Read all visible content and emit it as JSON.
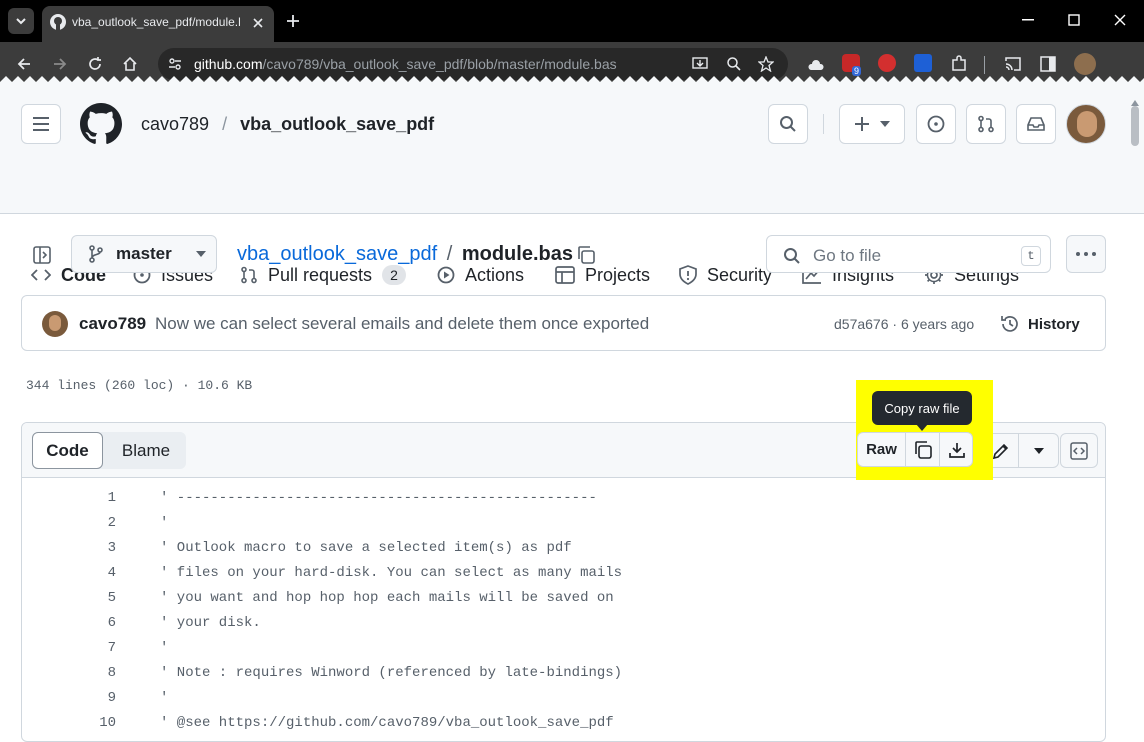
{
  "browser": {
    "tab_title": "vba_outlook_save_pdf/module.l",
    "url_domain": "github.com",
    "url_path": "/cavo789/vba_outlook_save_pdf/blob/master/module.bas",
    "ext_badge": "9"
  },
  "repo": {
    "owner": "cavo789",
    "separator": "/",
    "name": "vba_outlook_save_pdf"
  },
  "nav": [
    {
      "label": "Code",
      "icon": "code-icon"
    },
    {
      "label": "Issues",
      "icon": "issue-icon"
    },
    {
      "label": "Pull requests",
      "icon": "pull-request-icon",
      "count": "2"
    },
    {
      "label": "Actions",
      "icon": "play-icon"
    },
    {
      "label": "Projects",
      "icon": "table-icon"
    },
    {
      "label": "Security",
      "icon": "shield-icon"
    },
    {
      "label": "Insights",
      "icon": "graph-icon"
    },
    {
      "label": "Settings",
      "icon": "gear-icon"
    }
  ],
  "file": {
    "branch": "master",
    "repo_link": "vba_outlook_save_pdf",
    "separator": "/",
    "filename": "module.bas",
    "goto_placeholder": "Go to file",
    "goto_shortcut": "t"
  },
  "commit": {
    "author": "cavo789",
    "message": "Now we can select several emails and delete them once exported",
    "sha_time": "d57a676 · 6 years ago",
    "history_label": "History"
  },
  "stats": "344 lines (260 loc) · 10.6 KB",
  "viewer": {
    "code_tab": "Code",
    "blame_tab": "Blame",
    "raw_label": "Raw",
    "tooltip": "Copy raw file",
    "highlight_color": "#ffff00"
  },
  "code_lines": [
    {
      "n": "1",
      "text": "' --------------------------------------------------"
    },
    {
      "n": "2",
      "text": "'"
    },
    {
      "n": "3",
      "text": "' Outlook macro to save a selected item(s) as pdf"
    },
    {
      "n": "4",
      "text": "' files on your hard-disk. You can select as many mails"
    },
    {
      "n": "5",
      "text": "' you want and hop hop hop each mails will be saved on"
    },
    {
      "n": "6",
      "text": "' your disk."
    },
    {
      "n": "7",
      "text": "'"
    },
    {
      "n": "8",
      "text": "' Note : requires Winword (referenced by late-bindings)"
    },
    {
      "n": "9",
      "text": "'"
    },
    {
      "n": "10",
      "text": "' @see https://github.com/cavo789/vba_outlook_save_pdf"
    }
  ]
}
